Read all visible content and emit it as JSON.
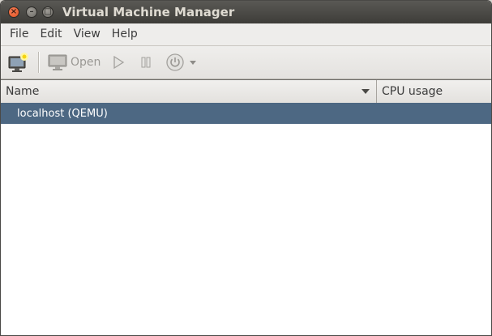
{
  "window": {
    "title": "Virtual Machine Manager"
  },
  "titlebar_buttons": {
    "close": "×",
    "minimize": "–",
    "maximize": "□"
  },
  "menu": [
    "File",
    "Edit",
    "View",
    "Help"
  ],
  "toolbar": {
    "open_label": "Open"
  },
  "columns": {
    "name": "Name",
    "cpu": "CPU usage"
  },
  "connections": [
    {
      "label": "localhost (QEMU)",
      "selected": true
    }
  ],
  "colors": {
    "titlebar": "#3d3c38",
    "selection": "#4d6883",
    "close_button": "#e0501f"
  }
}
